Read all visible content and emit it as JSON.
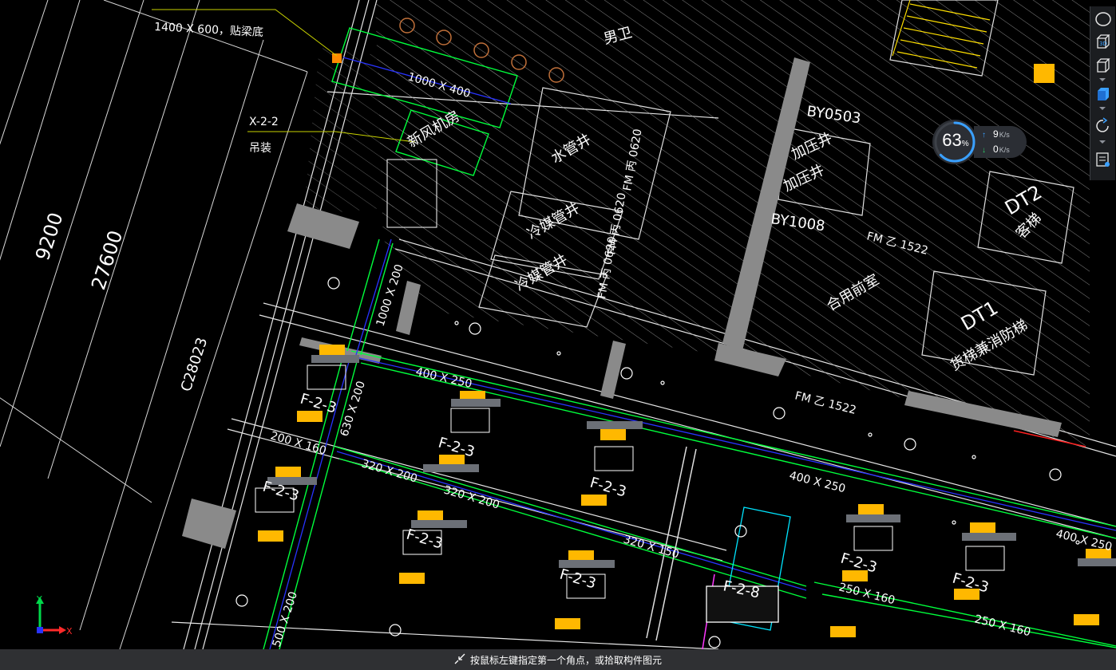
{
  "drawing": {
    "dims": {
      "left_major": "9200",
      "left_total": "27600",
      "column": "C28023"
    },
    "notes": {
      "top_label": "1400 X 600，贴梁底",
      "x22": "X-2-2",
      "hanger": "吊装"
    },
    "ducts": [
      "1000 X 400",
      "1000 X 200",
      "400 X 250",
      "630 X 200",
      "200 X 160",
      "320 X 200",
      "320 X 200",
      "320 X 150",
      "400 X 250",
      "400 X 250",
      "250 X 160",
      "250 X 160",
      "500 X 200"
    ],
    "rooms": {
      "fresh_air": "新风机房",
      "water_shaft": "水管井",
      "cold_shaft_1": "冷媒管井",
      "cold_shaft_2": "冷媒管井",
      "toilet": "男卫",
      "pressure_1": "加压井",
      "pressure_2": "加压井",
      "shared_lobby": "合用前室",
      "passenger_lift": "客梯",
      "freight_lift": "货梯兼消防梯",
      "dt1": "DT1",
      "dt2": "DT2",
      "by0503": "BY0503",
      "by1008": "BY1008",
      "fm1": "FM 乙 1522",
      "fm2": "FM 乙 1522",
      "fm3": "FM 丙 0620",
      "fm4": "FM 丙 0620",
      "fm5": "FM 丙 0620"
    },
    "fancoil_tags": [
      "F-2-3",
      "F-2-3",
      "F-2-3",
      "F-2-3",
      "F-2-3",
      "F-2-3",
      "F-2-3",
      "F-2-3",
      "F-2-8"
    ]
  },
  "toolbar": {
    "buttons": [
      "view-cube-icon",
      "3d-view-icon",
      "box-view-icon",
      "box-view-filled-icon",
      "rotate-icon",
      "properties-icon"
    ]
  },
  "network": {
    "percent": "63",
    "percent_unit": "%",
    "upload": "9",
    "upload_unit": "K/s",
    "download": "0",
    "download_unit": "K/s"
  },
  "axis": {
    "x": "X",
    "y": "Y"
  },
  "status": {
    "message": "按鼠标左键指定第一个角点，或拾取构件图元"
  },
  "colors": {
    "bg": "#000000",
    "duct": "#00ff3c",
    "pipe": "#2833ff",
    "wall": "#ffffff",
    "hatch": "#c7c7c7",
    "equipment": "#ffb800",
    "accent_cyan": "#00e5ff",
    "toolbar_blue": "#3aa0ff",
    "status_bg": "#2f3033"
  }
}
